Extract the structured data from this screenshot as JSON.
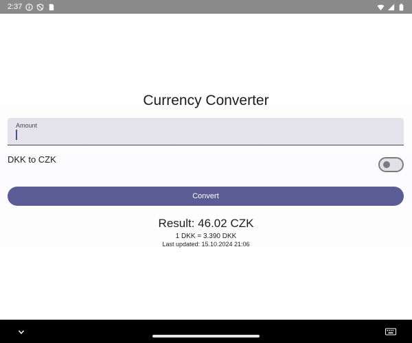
{
  "status_bar": {
    "time": "2:37",
    "icons": [
      "info-icon",
      "shield-off-icon",
      "sim-card-icon",
      "wifi-icon",
      "signal-icon",
      "battery-icon"
    ]
  },
  "app": {
    "title": "Currency Converter",
    "amount": {
      "label": "Amount",
      "value": ""
    },
    "toggle": {
      "label": "DKK to CZK",
      "checked": false
    },
    "convert_button": "Convert",
    "result": "Result: 46.02 CZK",
    "rate": "1 DKK = 3.390 DKK",
    "last_updated": "Last updated: 15.10.2024 21:06"
  },
  "colors": {
    "primary": "#5b5c96",
    "field_background": "#e4e2ea",
    "status_bar": "#8a8a8a",
    "nav_bar": "#000000"
  },
  "nav_bar": {
    "icons": [
      "chevron-down-icon",
      "home-handle",
      "keyboard-icon"
    ]
  }
}
